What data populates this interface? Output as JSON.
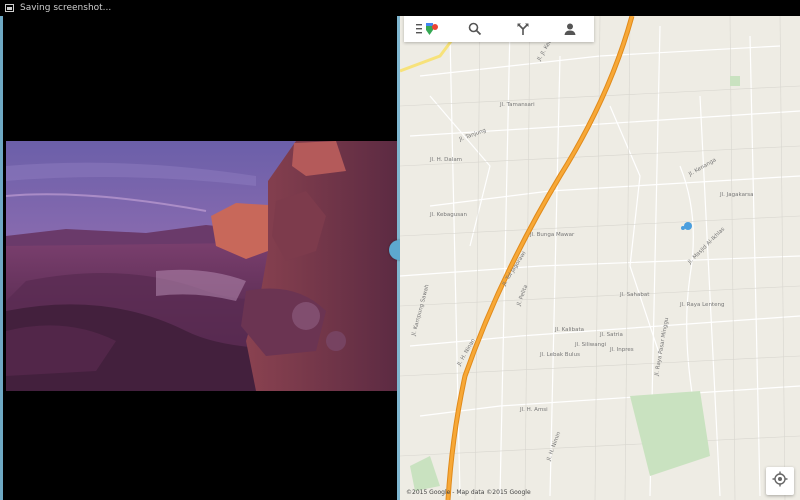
{
  "status_bar": {
    "text": "Saving screenshot..."
  },
  "map": {
    "streets": [
      "Jl. Jl. Ketupat",
      "Jl. Tamansari",
      "Jl. H. Dalam",
      "Jl. Kenanga",
      "Jl. Jagakarsa",
      "Jl. Tanjung",
      "Jl. Kebagusan",
      "Jl. Masjid Al-Ikhlas",
      "Jl. Sahabat",
      "Jl. H. Ninan",
      "Jl. Pelita",
      "Jl. Kalibata",
      "Jl. Siliwangi",
      "Jl. Lebak Bulus",
      "Jl. Raya Lenteng",
      "Jl. Satria",
      "Jl. Inpres",
      "Jl. H. Amsi",
      "Jl. H. Nimin",
      "Jl. Kampung Sawah",
      "Jl. Raya Pasar Minggu",
      "Jl. Tol Jagorawi",
      "Jl. Bunga Mawar"
    ],
    "copyright": "©2015 Google - Map data ©2015 Google"
  },
  "icons": {
    "menu": "menu-icon",
    "search": "search-icon",
    "directions": "directions-icon",
    "account": "account-icon",
    "locate": "my-location-icon"
  },
  "colors": {
    "accent": "#5da8cf",
    "highway": "#f39a1f",
    "map_bg": "#eeece4"
  }
}
